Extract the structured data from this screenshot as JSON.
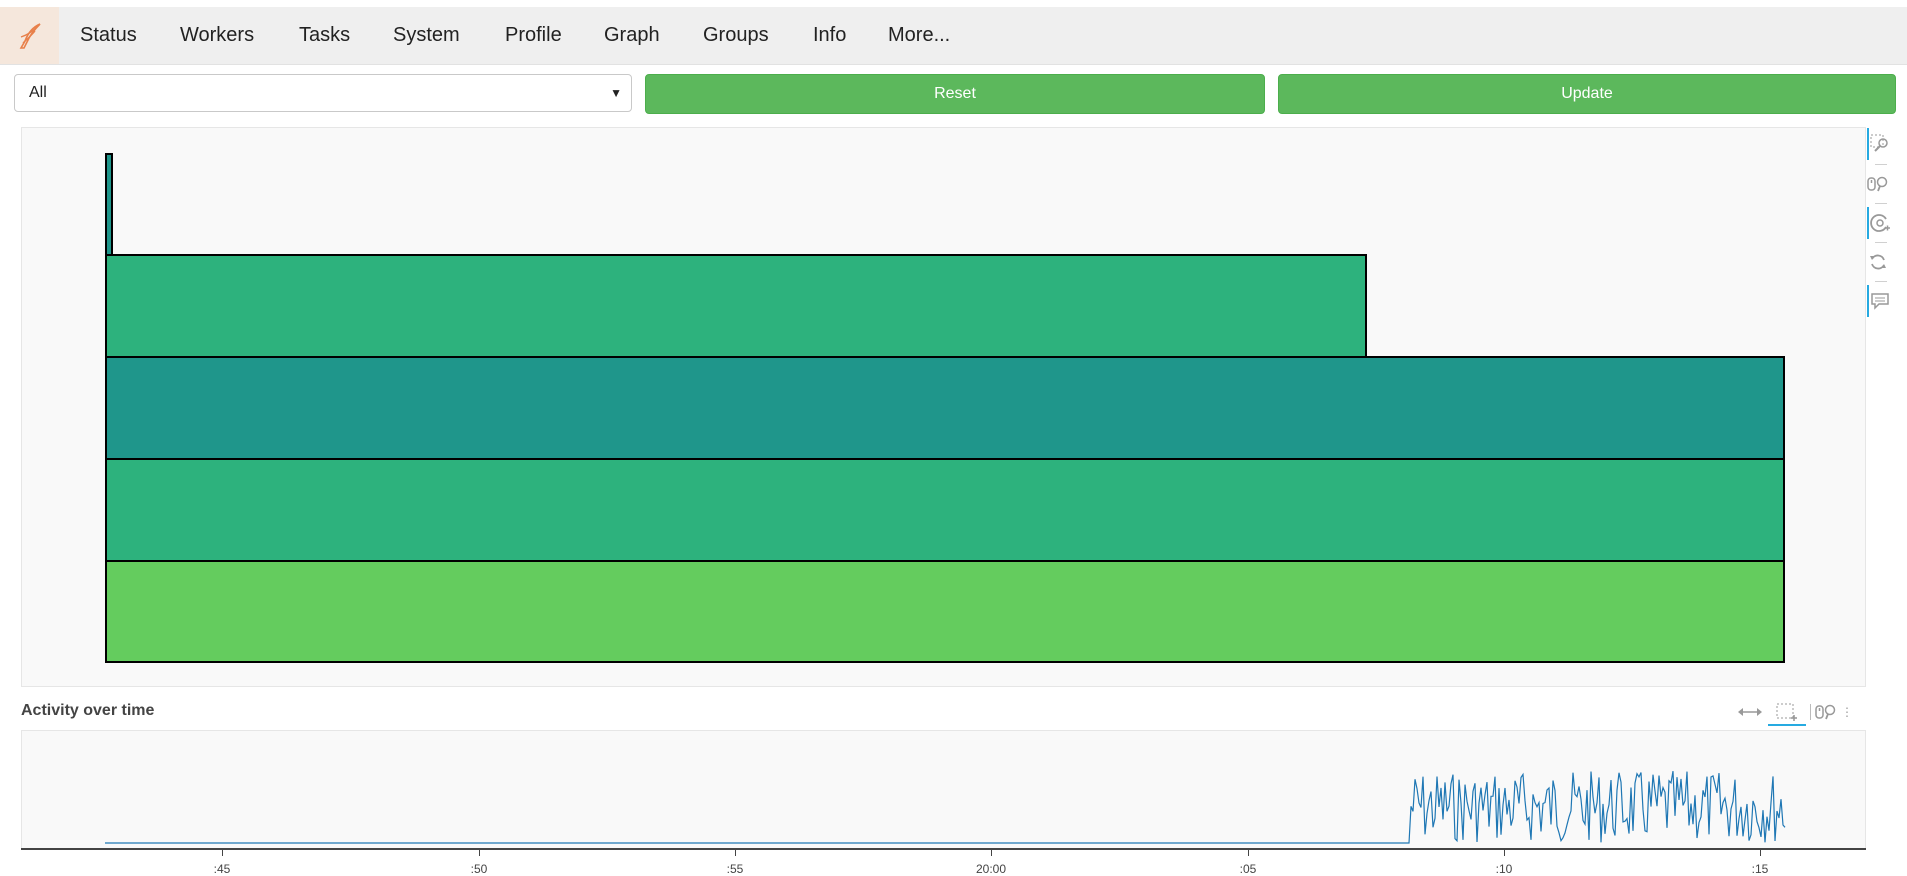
{
  "nav": {
    "items": [
      "Status",
      "Workers",
      "Tasks",
      "System",
      "Profile",
      "Graph",
      "Groups",
      "Info",
      "More..."
    ]
  },
  "controls": {
    "select_value": "All",
    "reset_label": "Reset",
    "update_label": "Update"
  },
  "activity": {
    "title": "Activity over time",
    "ticks": [
      ":45",
      ":50",
      ":55",
      "20:00",
      ":05",
      ":10",
      ":15"
    ]
  },
  "toolbar": {
    "icons": [
      "box-zoom-icon",
      "wheel-zoom-icon",
      "reset-view-icon",
      "refresh-icon",
      "hover-tooltip-icon"
    ]
  },
  "colors": {
    "accent_button": "#5cb85c",
    "bar_light_green": "#64cc5e",
    "bar_green": "#2db27d",
    "bar_teal": "#1f968b",
    "activity_line": "#1f77b4",
    "logo_orange": "#e8804a"
  },
  "chart_data": [
    {
      "type": "bar",
      "series": [
        {
          "name": "",
          "color": "#64cc5e",
          "values": [
            1.0
          ]
        },
        {
          "name": "",
          "color": "#2db27d",
          "values": [
            1.0
          ]
        },
        {
          "name": "",
          "color": "#1f968b",
          "values": [
            1.0
          ]
        },
        {
          "name": "",
          "color": "#2db27d",
          "values": [
            0.75
          ]
        },
        {
          "name": "",
          "color": "#1f968b",
          "values": [
            0.004
          ]
        }
      ],
      "xlabel": "",
      "ylabel": ""
    },
    {
      "type": "line",
      "title": "Activity over time",
      "x_ticks": [
        ":45",
        ":50",
        ":55",
        "20:00",
        ":05",
        ":10",
        ":15"
      ],
      "description": "flat near zero until about :08, then noisy high activity until about :15"
    }
  ]
}
